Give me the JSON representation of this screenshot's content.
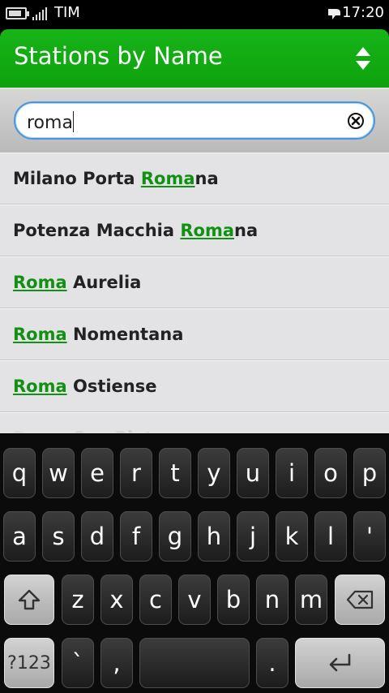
{
  "status_bar": {
    "carrier": "TIM",
    "time": "17:20",
    "battery_level": 0.7
  },
  "header": {
    "title": "Stations by Name",
    "sort_icon": "sort-up-down-icon"
  },
  "search": {
    "value": "roma",
    "clear_icon": "clear-circle-icon"
  },
  "results": [
    {
      "before": "Milano Porta ",
      "match": "Roma",
      "after": "na"
    },
    {
      "before": "Potenza Macchia ",
      "match": "Roma",
      "after": "na"
    },
    {
      "before": "",
      "match": "Roma",
      "after": " Aurelia"
    },
    {
      "before": "",
      "match": "Roma",
      "after": " Nomentana"
    },
    {
      "before": "",
      "match": "Roma",
      "after": " Ostiense"
    },
    {
      "before": "",
      "match": "Roma",
      "after": " San Pietro"
    }
  ],
  "keyboard": {
    "row1": [
      "q",
      "w",
      "e",
      "r",
      "t",
      "y",
      "u",
      "i",
      "o",
      "p"
    ],
    "row2": [
      "a",
      "s",
      "d",
      "f",
      "g",
      "h",
      "j",
      "k",
      "l",
      "'"
    ],
    "row3": [
      "z",
      "x",
      "c",
      "v",
      "b",
      "n",
      "m"
    ],
    "symbols": "?123",
    "backtick": "`",
    "comma": ",",
    "period": ".",
    "shift_icon": "shift-arrow-icon",
    "backspace_icon": "backspace-icon",
    "enter_icon": "enter-return-icon"
  },
  "colors": {
    "accent_green": "#119011",
    "header_green": "#17b417",
    "search_border": "#4a95d8"
  }
}
